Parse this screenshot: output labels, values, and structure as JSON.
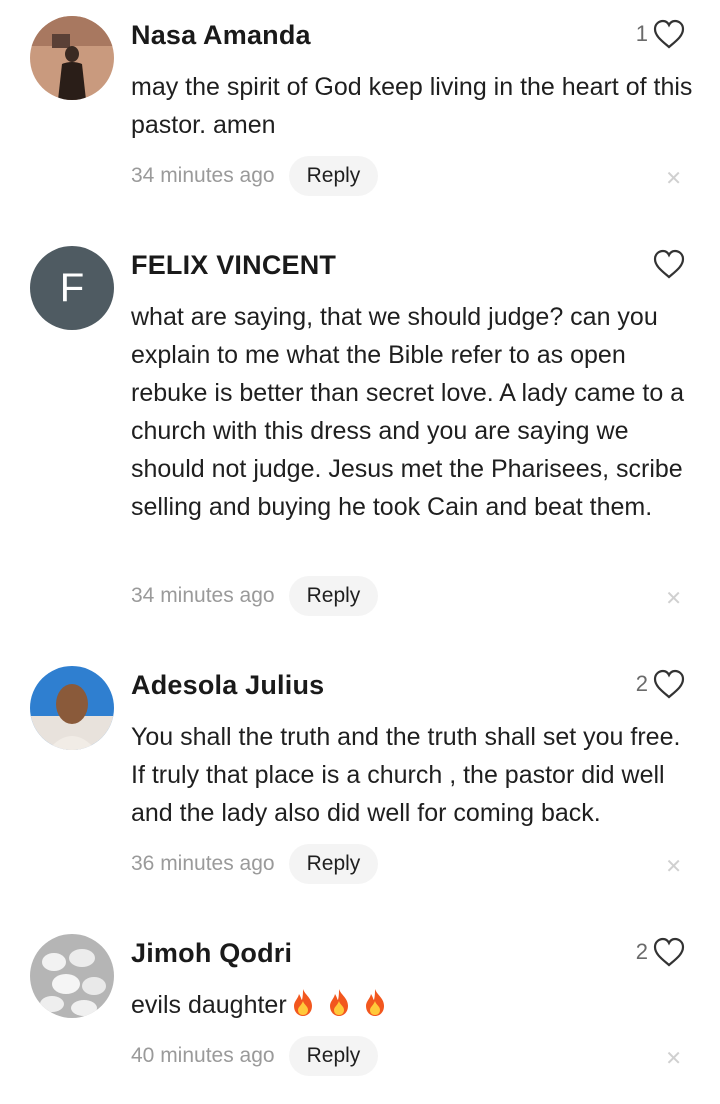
{
  "comments": [
    {
      "name": "Nasa Amanda",
      "likes": "1",
      "text": "may the spirit of God keep living in the heart of this pastor. amen",
      "time": "34 minutes ago",
      "reply": "Reply",
      "avatar_type": "photo",
      "avatar_colors": [
        "#b88a70",
        "#3a2a22"
      ]
    },
    {
      "name": "FELIX VINCENT",
      "likes": "",
      "text": "what are saying, that we should judge? can you explain to me what the Bible refer to as open rebuke is better than secret love. A lady came to a church with this dress and you are saying we should not judge. Jesus met the Pharisees, scribe selling and buying he took Cain and beat them.",
      "time": "34 minutes ago",
      "reply": "Reply",
      "avatar_type": "letter",
      "avatar_letter": "F"
    },
    {
      "name": "Adesola Julius",
      "likes": "2",
      "text": "You shall the truth and the truth shall set you free. If truly that place is a church , the pastor did well and the lady also did well for coming back.",
      "time": "36 minutes ago",
      "reply": "Reply",
      "avatar_type": "photo",
      "avatar_colors": [
        "#2f7fd0",
        "#8a5a3a"
      ]
    },
    {
      "name": "Jimoh Qodri",
      "likes": "2",
      "text": "evils daughter",
      "emoji": "fire-emoji x3",
      "time": "40 minutes ago",
      "reply": "Reply",
      "avatar_type": "photo",
      "avatar_colors": [
        "#d8d8d8",
        "#8c8c8c"
      ]
    }
  ],
  "icons": {
    "like": "heart-outline-icon",
    "dismiss": "close-icon"
  },
  "colors": {
    "text": "#1f1f1f",
    "meta": "#9a9a9a",
    "reply_bg": "#f4f4f4",
    "letter_avatar": "#4f5b62"
  }
}
